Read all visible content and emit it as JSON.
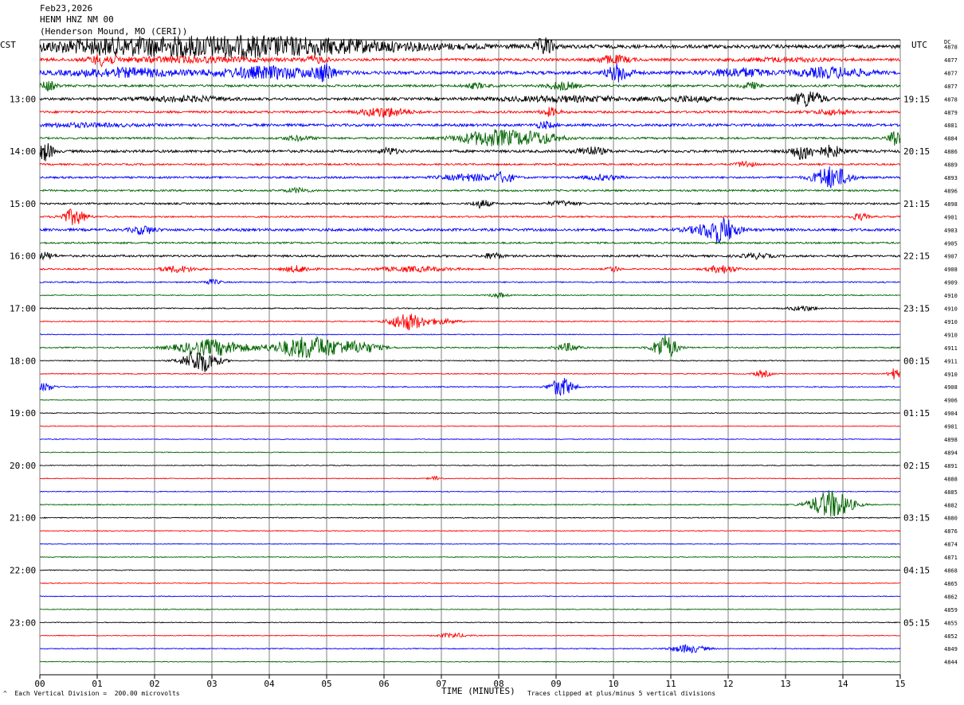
{
  "header": {
    "date": "Feb23,2026",
    "station": "HENM HNZ NM 00",
    "location": "(Henderson Mound, MO (CERI))"
  },
  "left_tz": "CST",
  "right_tz": "UTC",
  "dc_label": "DC",
  "footer": {
    "scale_note": "Each Vertical Division =  200.00 microvolts",
    "scale_marker": "^",
    "clip_note": "Traces clipped at plus/minus 5 vertical divisions"
  },
  "colors": {
    "cycle": [
      "#000000",
      "#ff0000",
      "#0000ff",
      "#006400"
    ],
    "grid": "#7f7f7f"
  },
  "chart_data": {
    "type": "line",
    "title": "Feb23,2026 HENM HNZ NM 00 (Henderson Mound, MO (CERI))",
    "xlabel": "TIME (MINUTES)",
    "xlim": [
      0,
      15
    ],
    "x_ticks": [
      "00",
      "01",
      "02",
      "03",
      "04",
      "05",
      "06",
      "07",
      "08",
      "09",
      "10",
      "11",
      "12",
      "13",
      "14",
      "15"
    ],
    "left_labels": [
      {
        "row": 4,
        "text": "13:00"
      },
      {
        "row": 8,
        "text": "14:00"
      },
      {
        "row": 12,
        "text": "15:00"
      },
      {
        "row": 16,
        "text": "16:00"
      },
      {
        "row": 20,
        "text": "17:00"
      },
      {
        "row": 24,
        "text": "18:00"
      },
      {
        "row": 28,
        "text": "19:00"
      },
      {
        "row": 32,
        "text": "20:00"
      },
      {
        "row": 36,
        "text": "21:00"
      },
      {
        "row": 40,
        "text": "22:00"
      },
      {
        "row": 44,
        "text": "23:00"
      }
    ],
    "right_labels": [
      {
        "row": 0,
        "text": "UTC"
      },
      {
        "row": 4,
        "text": "19:15"
      },
      {
        "row": 8,
        "text": "20:15"
      },
      {
        "row": 12,
        "text": "21:15"
      },
      {
        "row": 16,
        "text": "22:15"
      },
      {
        "row": 20,
        "text": "23:15"
      },
      {
        "row": 24,
        "text": "00:15"
      },
      {
        "row": 28,
        "text": "01:15"
      },
      {
        "row": 32,
        "text": "02:15"
      },
      {
        "row": 36,
        "text": "03:15"
      },
      {
        "row": 40,
        "text": "04:15"
      },
      {
        "row": 44,
        "text": "05:15"
      }
    ],
    "dc_values": [
      "4878",
      "4877",
      "4877",
      "4877",
      "4878",
      "4879",
      "4881",
      "4884",
      "4886",
      "4889",
      "4893",
      "4896",
      "4898",
      "4901",
      "4903",
      "4905",
      "4907",
      "4908",
      "4909",
      "4910",
      "4910",
      "4910",
      "4910",
      "4911",
      "4911",
      "4910",
      "4908",
      "4906",
      "4904",
      "4901",
      "4898",
      "4894",
      "4891",
      "4888",
      "4885",
      "4882",
      "4880",
      "4876",
      "4874",
      "4871",
      "4868",
      "4865",
      "4862",
      "4859",
      "4855",
      "4852",
      "4849",
      "4844"
    ],
    "traces": [
      {
        "row": 0,
        "noise": 2.2,
        "events": [
          [
            1.1,
            1.8,
            2
          ],
          [
            2.0,
            5.5,
            5
          ],
          [
            3.9,
            5.4,
            9
          ],
          [
            8.8,
            0.3,
            11
          ]
        ]
      },
      {
        "row": 1,
        "noise": 1.6,
        "events": [
          [
            1.1,
            0.4,
            6
          ],
          [
            2.5,
            3,
            3
          ],
          [
            4.8,
            0.4,
            4
          ],
          [
            10.0,
            0.6,
            5
          ],
          [
            13.0,
            1.5,
            2
          ]
        ]
      },
      {
        "row": 2,
        "noise": 2,
        "events": [
          [
            1.5,
            2,
            5
          ],
          [
            4.0,
            1.8,
            7
          ],
          [
            4.98,
            0.3,
            10
          ],
          [
            10.1,
            0.4,
            11
          ],
          [
            12.2,
            1,
            5
          ],
          [
            13.8,
            1.2,
            6
          ]
        ]
      },
      {
        "row": 3,
        "noise": 1.4,
        "events": [
          [
            0.15,
            0.25,
            6
          ],
          [
            7.6,
            0.4,
            3
          ],
          [
            9.1,
            0.5,
            5
          ],
          [
            12.4,
            0.3,
            4
          ]
        ]
      },
      {
        "row": 4,
        "noise": 1.6,
        "events": [
          [
            2.5,
            1.5,
            3
          ],
          [
            9.2,
            2.5,
            3
          ],
          [
            11.3,
            1,
            3
          ],
          [
            13.4,
            0.5,
            10
          ]
        ]
      },
      {
        "row": 5,
        "noise": 1.4,
        "events": [
          [
            6.0,
            0.8,
            6
          ],
          [
            8.9,
            0.3,
            5
          ],
          [
            13.8,
            0.6,
            3
          ]
        ]
      },
      {
        "row": 6,
        "noise": 1.6,
        "events": [
          [
            0.7,
            1.5,
            2
          ],
          [
            8.8,
            0.3,
            4
          ]
        ]
      },
      {
        "row": 7,
        "noise": 1.2,
        "events": [
          [
            4.5,
            0.5,
            3
          ],
          [
            7.9,
            1.2,
            10
          ],
          [
            8.7,
            0.8,
            6
          ],
          [
            14.9,
            0.2,
            12
          ]
        ]
      },
      {
        "row": 8,
        "noise": 1.6,
        "events": [
          [
            0.1,
            0.25,
            12
          ],
          [
            6.1,
            0.3,
            4
          ],
          [
            9.6,
            0.5,
            5
          ],
          [
            13.3,
            0.4,
            10
          ],
          [
            13.8,
            0.4,
            7
          ]
        ]
      },
      {
        "row": 9,
        "noise": 1.1,
        "events": [
          [
            12.3,
            0.3,
            4
          ]
        ]
      },
      {
        "row": 10,
        "noise": 1.2,
        "events": [
          [
            7.5,
            1,
            4
          ],
          [
            8.1,
            0.3,
            6
          ],
          [
            9.8,
            0.6,
            3
          ],
          [
            13.8,
            0.6,
            14
          ]
        ]
      },
      {
        "row": 11,
        "noise": 1.1,
        "events": [
          [
            4.5,
            0.4,
            3
          ]
        ]
      },
      {
        "row": 12,
        "noise": 1.1,
        "events": [
          [
            7.7,
            0.3,
            5
          ],
          [
            9.1,
            0.5,
            3
          ]
        ]
      },
      {
        "row": 13,
        "noise": 1,
        "events": [
          [
            0.6,
            0.4,
            10
          ],
          [
            14.3,
            0.3,
            4
          ]
        ]
      },
      {
        "row": 14,
        "noise": 1.6,
        "events": [
          [
            1.8,
            0.4,
            5
          ],
          [
            11.7,
            0.8,
            6
          ],
          [
            11.9,
            0.5,
            11
          ]
        ]
      },
      {
        "row": 15,
        "noise": 1.1,
        "events": []
      },
      {
        "row": 16,
        "noise": 1.3,
        "events": [
          [
            0.1,
            0.3,
            4
          ],
          [
            7.9,
            0.3,
            4
          ],
          [
            12.5,
            0.5,
            3
          ]
        ]
      },
      {
        "row": 17,
        "noise": 0.9,
        "events": [
          [
            2.4,
            0.6,
            4
          ],
          [
            4.5,
            0.5,
            4
          ],
          [
            6.5,
            1.3,
            3
          ],
          [
            10.0,
            0.2,
            4
          ],
          [
            11.9,
            0.5,
            5
          ]
        ]
      },
      {
        "row": 18,
        "noise": 0.8,
        "events": [
          [
            3.0,
            0.3,
            3
          ]
        ]
      },
      {
        "row": 19,
        "noise": 0.6,
        "events": [
          [
            8.0,
            0.3,
            3
          ]
        ]
      },
      {
        "row": 20,
        "noise": 0.7,
        "events": [
          [
            13.3,
            0.5,
            3
          ]
        ]
      },
      {
        "row": 21,
        "noise": 0.6,
        "events": [
          [
            6.4,
            0.6,
            11
          ],
          [
            7.0,
            0.6,
            3
          ]
        ]
      },
      {
        "row": 22,
        "noise": 0.5,
        "events": []
      },
      {
        "row": 23,
        "noise": 0.8,
        "events": [
          [
            3.0,
            1.2,
            10
          ],
          [
            4.7,
            1.2,
            14
          ],
          [
            5.6,
            0.7,
            6
          ],
          [
            9.2,
            0.4,
            5
          ],
          [
            10.9,
            0.4,
            16
          ]
        ]
      },
      {
        "row": 24,
        "noise": 0.6,
        "events": [
          [
            2.8,
            0.6,
            15
          ]
        ]
      },
      {
        "row": 25,
        "noise": 0.6,
        "events": [
          [
            12.6,
            0.3,
            4
          ],
          [
            14.9,
            0.2,
            7
          ]
        ]
      },
      {
        "row": 26,
        "noise": 0.7,
        "events": [
          [
            0.1,
            0.3,
            5
          ],
          [
            9.1,
            0.4,
            12
          ]
        ]
      },
      {
        "row": 27,
        "noise": 0.5,
        "events": []
      },
      {
        "row": 28,
        "noise": 0.5,
        "events": []
      },
      {
        "row": 29,
        "noise": 0.5,
        "events": []
      },
      {
        "row": 30,
        "noise": 0.5,
        "events": []
      },
      {
        "row": 31,
        "noise": 0.5,
        "events": []
      },
      {
        "row": 32,
        "noise": 0.5,
        "events": []
      },
      {
        "row": 33,
        "noise": 0.5,
        "events": [
          [
            6.9,
            0.2,
            3
          ]
        ]
      },
      {
        "row": 34,
        "noise": 0.5,
        "events": []
      },
      {
        "row": 35,
        "noise": 0.6,
        "events": [
          [
            13.8,
            0.7,
            18
          ]
        ]
      },
      {
        "row": 36,
        "noise": 0.6,
        "events": []
      },
      {
        "row": 37,
        "noise": 0.5,
        "events": []
      },
      {
        "row": 38,
        "noise": 0.5,
        "events": []
      },
      {
        "row": 39,
        "noise": 0.5,
        "events": []
      },
      {
        "row": 40,
        "noise": 0.5,
        "events": []
      },
      {
        "row": 41,
        "noise": 0.5,
        "events": []
      },
      {
        "row": 42,
        "noise": 0.5,
        "events": []
      },
      {
        "row": 43,
        "noise": 0.5,
        "events": []
      },
      {
        "row": 44,
        "noise": 0.5,
        "events": []
      },
      {
        "row": 45,
        "noise": 0.5,
        "events": [
          [
            7.2,
            0.5,
            3
          ]
        ]
      },
      {
        "row": 46,
        "noise": 0.6,
        "events": [
          [
            11.3,
            0.6,
            5
          ]
        ]
      },
      {
        "row": 47,
        "noise": 0.5,
        "events": []
      }
    ]
  }
}
